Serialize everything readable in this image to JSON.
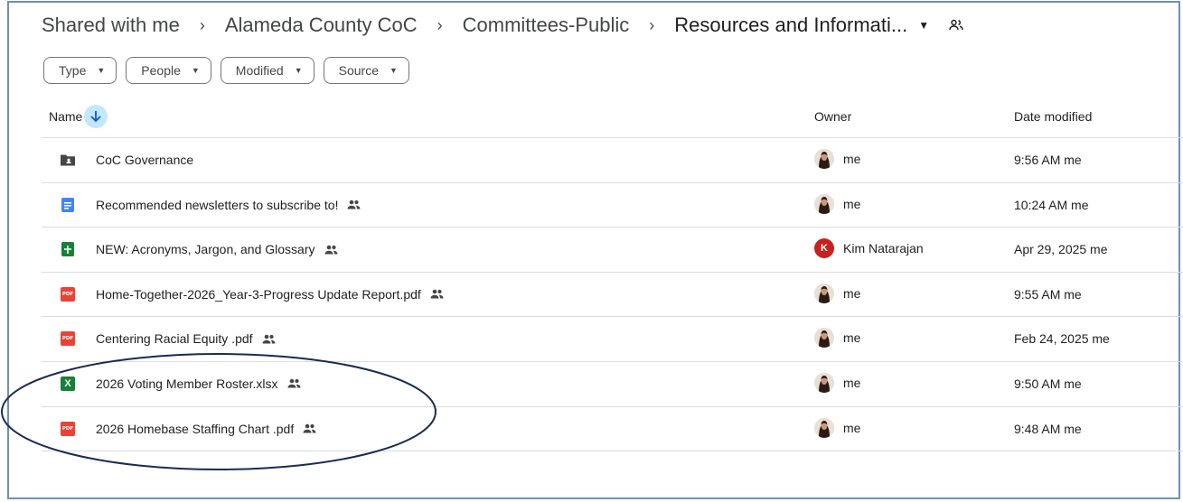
{
  "breadcrumb": {
    "items": [
      "Shared with me",
      "Alameda County CoC",
      "Committees-Public"
    ],
    "current": "Resources and Informati..."
  },
  "filters": [
    "Type",
    "People",
    "Modified",
    "Source"
  ],
  "columns": {
    "name": "Name",
    "owner": "Owner",
    "date": "Date modified"
  },
  "files": [
    {
      "name": "CoC Governance",
      "type": "shared-folder",
      "shared": false,
      "owner": "me",
      "owner_avatar": "photo",
      "date": "9:56 AM me"
    },
    {
      "name": "Recommended newsletters to subscribe to!",
      "type": "google-doc",
      "shared": true,
      "owner": "me",
      "owner_avatar": "photo",
      "date": "10:24 AM me"
    },
    {
      "name": "NEW: Acronyms, Jargon, and Glossary",
      "type": "google-sheet",
      "shared": true,
      "owner": "Kim Natarajan",
      "owner_avatar": "K",
      "date": "Apr 29, 2025 me"
    },
    {
      "name": "Home-Together-2026_Year-3-Progress Update Report.pdf",
      "type": "pdf",
      "shared": true,
      "owner": "me",
      "owner_avatar": "photo",
      "date": "9:55 AM me"
    },
    {
      "name": "Centering Racial Equity .pdf",
      "type": "pdf",
      "shared": true,
      "owner": "me",
      "owner_avatar": "photo",
      "date": "Feb 24, 2025 me"
    },
    {
      "name": "2026 Voting Member Roster.xlsx",
      "type": "excel",
      "shared": true,
      "owner": "me",
      "owner_avatar": "photo",
      "date": "9:50 AM me"
    },
    {
      "name": "2026 Homebase Staffing Chart .pdf",
      "type": "pdf",
      "shared": true,
      "owner": "me",
      "owner_avatar": "photo",
      "date": "9:48 AM me"
    }
  ],
  "icons": {
    "pdf_label": "PDF",
    "excel_label": "X",
    "sort": "arrow-down-icon",
    "shared": "people-icon"
  },
  "colors": {
    "sort_bg": "#c2e7ff",
    "doc": "#4285f4",
    "sheet": "#188038",
    "pdf": "#ea4335",
    "annotation": "#1c2a52"
  }
}
